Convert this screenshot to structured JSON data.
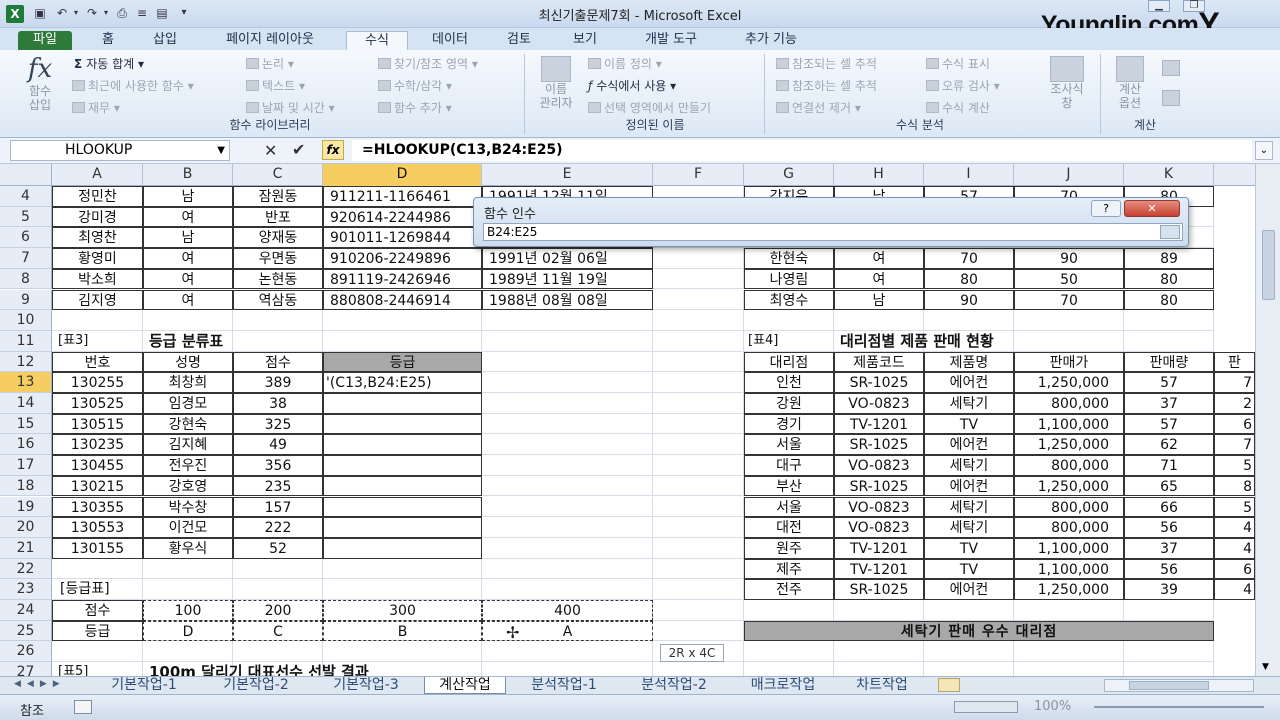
{
  "window": {
    "title": "최신기출문제7회 - Microsoft Excel",
    "brand": "Younglin.com"
  },
  "tabs": [
    "파일",
    "홈",
    "삽입",
    "페이지 레이아웃",
    "수식",
    "데이터",
    "검토",
    "보기",
    "개발 도구",
    "추가 기능"
  ],
  "ribbon": {
    "insert_fn": "함수\n삽입",
    "autosum": "자동 합계",
    "recent": "최근에 사용한 함수",
    "finance": "재무",
    "logical": "논리",
    "text": "텍스트",
    "datetime": "날짜 및 시간",
    "lookup": "찾기/참조 영역",
    "math": "수학/삼각",
    "more": "함수 추가",
    "grp_library": "함수 라이브러리",
    "name_mgr": "이름\n관리자",
    "define_name": "이름 정의",
    "use_in_formula": "수식에서 사용",
    "create_from_sel": "선택 영역에서 만들기",
    "grp_names": "정의된 이름",
    "trace_prec": "참조되는 셀 추적",
    "trace_dep": "참조하는 셀 추적",
    "remove_arrows": "연결선 제거",
    "show_formulas": "수식 표시",
    "error_check": "오류 검사",
    "eval_formula": "수식 계산",
    "grp_audit": "수식 분석",
    "watch": "조사식\n창",
    "calc_opts": "계산\n옵션",
    "grp_calc": "계산"
  },
  "formula_bar": {
    "name_box": "HLOOKUP",
    "formula": "=HLOOKUP(C13,B24:E25)"
  },
  "columns": [
    "A",
    "B",
    "C",
    "D",
    "E",
    "F",
    "G",
    "H",
    "I",
    "J",
    "K"
  ],
  "rows": [
    "4",
    "5",
    "6",
    "7",
    "8",
    "9",
    "10",
    "11",
    "12",
    "13",
    "14",
    "15",
    "16",
    "17",
    "18",
    "19",
    "20",
    "21",
    "22",
    "23",
    "24",
    "25",
    "26",
    "27"
  ],
  "top_rows": [
    [
      "정민찬",
      "남",
      "잠원동",
      "911211-1166461",
      "1991년 12월 11일"
    ],
    [
      "강미경",
      "여",
      "반포",
      "920614-2244986",
      ""
    ],
    [
      "최영찬",
      "남",
      "양재동",
      "901011-1269844",
      ""
    ],
    [
      "황영미",
      "여",
      "우면동",
      "910206-2249896",
      "1991년 02월 06일"
    ],
    [
      "박소희",
      "여",
      "논현동",
      "891119-2426946",
      "1989년 11월 19일"
    ],
    [
      "김지영",
      "여",
      "역삼동",
      "880808-2446914",
      "1988년 08월 08일"
    ]
  ],
  "right_top_rows": [
    [
      "강지은",
      "남",
      "57",
      "70",
      "80"
    ],
    [
      "",
      "",
      "",
      "",
      ""
    ],
    [
      "",
      "",
      "",
      "",
      ""
    ],
    [
      "한현숙",
      "여",
      "70",
      "90",
      "89"
    ],
    [
      "나영림",
      "여",
      "80",
      "50",
      "80"
    ],
    [
      "최영수",
      "남",
      "90",
      "70",
      "80"
    ]
  ],
  "table3": {
    "tag": "[표3]",
    "title": "등급 분류표",
    "headers": [
      "번호",
      "성명",
      "점수",
      "등급"
    ],
    "rows": [
      [
        "130255",
        "최창희",
        "389",
        "'(C13,B24:E25)"
      ],
      [
        "130525",
        "임경모",
        "38",
        ""
      ],
      [
        "130515",
        "강현숙",
        "325",
        ""
      ],
      [
        "130235",
        "김지혜",
        "49",
        ""
      ],
      [
        "130455",
        "전우진",
        "356",
        ""
      ],
      [
        "130215",
        "강호영",
        "235",
        ""
      ],
      [
        "130355",
        "박수창",
        "157",
        ""
      ],
      [
        "130553",
        "이건모",
        "222",
        ""
      ],
      [
        "130155",
        "황우식",
        "52",
        ""
      ]
    ]
  },
  "grade_table": {
    "tag": "[등급표]",
    "rows": [
      [
        "점수",
        "100",
        "200",
        "300",
        "400"
      ],
      [
        "등급",
        "D",
        "C",
        "B",
        "A"
      ]
    ]
  },
  "table5": {
    "tag": "[표5]",
    "title": "100m 달리기 대표선수 선발 결과"
  },
  "table4": {
    "tag": "[표4]",
    "title": "대리점별 제품 판매 현황",
    "headers": [
      "대리점",
      "제품코드",
      "제품명",
      "판매가",
      "판매량",
      "판"
    ],
    "rows": [
      [
        "인천",
        "SR-1025",
        "에어컨",
        "1,250,000",
        "57",
        "7"
      ],
      [
        "강원",
        "VO-0823",
        "세탁기",
        "800,000",
        "37",
        "2"
      ],
      [
        "경기",
        "TV-1201",
        "TV",
        "1,100,000",
        "57",
        "6"
      ],
      [
        "서울",
        "SR-1025",
        "에어컨",
        "1,250,000",
        "62",
        "7"
      ],
      [
        "대구",
        "VO-0823",
        "세탁기",
        "800,000",
        "71",
        "5"
      ],
      [
        "부산",
        "SR-1025",
        "에어컨",
        "1,250,000",
        "65",
        "8"
      ],
      [
        "서울",
        "VO-0823",
        "세탁기",
        "800,000",
        "66",
        "5"
      ],
      [
        "대전",
        "VO-0823",
        "세탁기",
        "800,000",
        "56",
        "4"
      ],
      [
        "원주",
        "TV-1201",
        "TV",
        "1,100,000",
        "37",
        "4"
      ],
      [
        "제주",
        "TV-1201",
        "TV",
        "1,100,000",
        "56",
        "6"
      ],
      [
        "전주",
        "SR-1025",
        "에어컨",
        "1,250,000",
        "39",
        "4"
      ]
    ],
    "footer": "세탁기 판매 우수 대리점"
  },
  "dialog": {
    "title": "함수 인수",
    "value": "B24:E25"
  },
  "size_tip": "2R x 4C",
  "sheets": [
    "기본작업-1",
    "기본작업-2",
    "기본작업-3",
    "계산작업",
    "분석작업-1",
    "분석작업-2",
    "매크로작업",
    "차트작업"
  ],
  "status": {
    "mode": "참조",
    "zoom": "100%"
  }
}
